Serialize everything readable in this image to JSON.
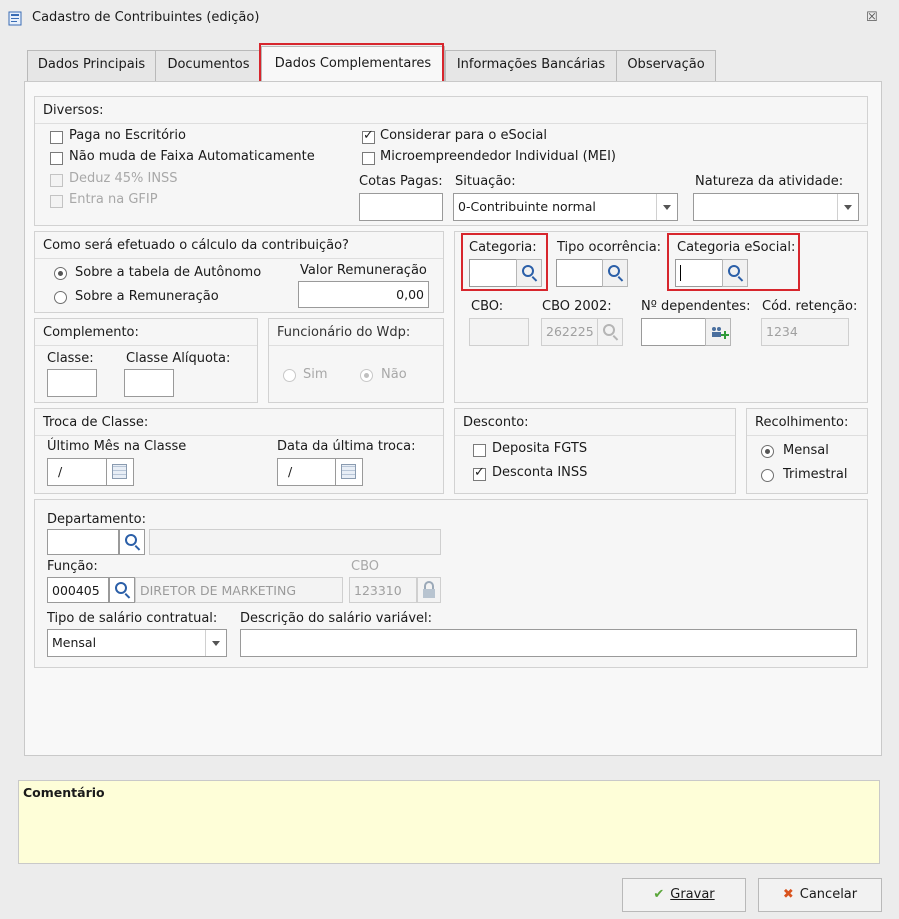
{
  "window": {
    "title": "Cadastro de Contribuintes (edição)",
    "close": "☒"
  },
  "tabs": [
    {
      "label": "Dados Principais"
    },
    {
      "label": "Documentos"
    },
    {
      "label": "Dados Complementares",
      "active": true
    },
    {
      "label": "Informações Bancárias"
    },
    {
      "label": "Observação"
    }
  ],
  "diversos": {
    "title": "Diversos:",
    "chk_paga": {
      "label": "Paga no Escritório",
      "checked": false
    },
    "chk_faixa": {
      "label": "Não muda de Faixa Automaticamente",
      "checked": false
    },
    "chk_deduz": {
      "label": "Deduz 45% INSS",
      "checked": false,
      "disabled": true
    },
    "chk_gfip": {
      "label": "Entra na GFIP",
      "checked": false,
      "disabled": true
    },
    "chk_esocial": {
      "label": "Considerar para o eSocial",
      "checked": true
    },
    "chk_mei": {
      "label": "Microempreendedor Individual (MEI)",
      "checked": false
    },
    "cotas_label": "Cotas Pagas:",
    "cotas_value": "",
    "situacao_label": "Situação:",
    "situacao_value": "0-Contribuinte normal",
    "natureza_label": "Natureza da atividade:",
    "natureza_value": ""
  },
  "calculo": {
    "title": "Como será efetuado o cálculo da contribuição?",
    "opt_autonomo": "Sobre a tabela de Autônomo",
    "opt_remuneracao": "Sobre a Remuneração",
    "valor_label": "Valor Remuneração",
    "valor_value": "0,00"
  },
  "categoria": {
    "categoria_label": "Categoria:",
    "categoria_value": "",
    "tipo_label": "Tipo ocorrência:",
    "tipo_value": "",
    "cat_esocial_label": "Categoria eSocial:",
    "cat_esocial_value": "",
    "cbo_label": "CBO:",
    "cbo_value": "",
    "cbo2002_label": "CBO 2002:",
    "cbo2002_value": "262225",
    "dependentes_label": "Nº dependentes:",
    "dependentes_value": "",
    "retencao_label": "Cód. retenção:",
    "retencao_value": "1234"
  },
  "complemento": {
    "title": "Complemento:",
    "classe_label": "Classe:",
    "aliquota_label": "Classe Alíquota:",
    "classe_value": "",
    "aliquota_value": ""
  },
  "funcionario": {
    "title": "Funcionário do Wdp:",
    "sim": "Sim",
    "nao": "Não"
  },
  "troca": {
    "title": "Troca de Classe:",
    "ultimo_label": "Último Mês na Classe",
    "ultimo_value": "/",
    "data_label": "Data da última troca:",
    "data_value": "/"
  },
  "desconto": {
    "title": "Desconto:",
    "fgts": "Deposita FGTS",
    "inss": "Desconta INSS"
  },
  "recolhimento": {
    "title": "Recolhimento:",
    "mensal": "Mensal",
    "trimestral": "Trimestral"
  },
  "departamento": {
    "label": "Departamento:",
    "code": "",
    "desc": ""
  },
  "funcao": {
    "label": "Função:",
    "code": "000405",
    "desc": "DIRETOR DE MARKETING",
    "cbo_label": "CBO",
    "cbo_value": "123310"
  },
  "salario": {
    "tipo_label": "Tipo de salário contratual:",
    "tipo_value": "Mensal",
    "desc_label": "Descrição do salário variável:",
    "desc_value": ""
  },
  "comentario": {
    "label": "Comentário",
    "value": ""
  },
  "buttons": {
    "gravar": "Gravar",
    "cancelar": "Cancelar"
  },
  "colors": {
    "highlight": "#d7262d",
    "comment_bg": "#fefed8",
    "link_icon": "#2b5fa8"
  }
}
